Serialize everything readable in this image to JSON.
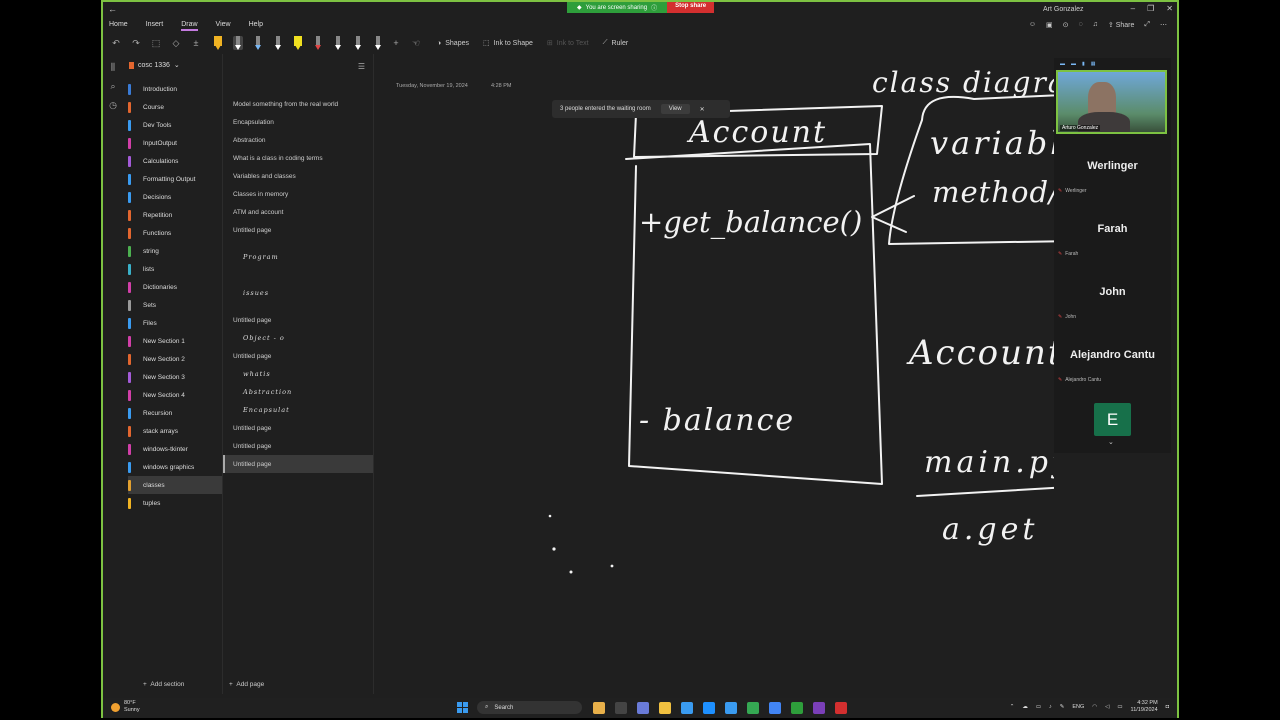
{
  "titlebar": {
    "share_status": "You are screen sharing",
    "stop_share": "Stop share",
    "user_name": "Art Gonzalez"
  },
  "menu": {
    "home": "Home",
    "insert": "Insert",
    "draw": "Draw",
    "view": "View",
    "help": "Help"
  },
  "header_actions": {
    "share": "Share"
  },
  "toolbar": {
    "shapes": "Shapes",
    "ink_to_shape": "Ink to Shape",
    "ink_to_text": "Ink to Text",
    "ruler": "Ruler",
    "pen_colors": [
      "#f0b323",
      "#ffffff",
      "#7ab8f5",
      "#ffffff",
      "#f0e020",
      "#e04545",
      "#ffffff",
      "#ffffff",
      "#ffffff"
    ]
  },
  "notebook": {
    "title": "cosc 1336"
  },
  "sections": [
    {
      "label": "Introduction",
      "color": "#3a7bd5"
    },
    {
      "label": "Course",
      "color": "#e2662f"
    },
    {
      "label": "Dev Tools",
      "color": "#3a9bf0"
    },
    {
      "label": "InputOutput",
      "color": "#d13fa8"
    },
    {
      "label": "Calculations",
      "color": "#a45bd8"
    },
    {
      "label": "Formatting Output",
      "color": "#3a9bf0"
    },
    {
      "label": "Decisions",
      "color": "#3a9bf0"
    },
    {
      "label": "Repetition",
      "color": "#e2662f"
    },
    {
      "label": "Functions",
      "color": "#e2662f"
    },
    {
      "label": "string",
      "color": "#4cb050"
    },
    {
      "label": "lists",
      "color": "#3ab0c8"
    },
    {
      "label": "Dictionaries",
      "color": "#d13fa8"
    },
    {
      "label": "Sets",
      "color": "#9a9a9a"
    },
    {
      "label": "Files",
      "color": "#3a9bf0"
    },
    {
      "label": "New Section 1",
      "color": "#d13fa8"
    },
    {
      "label": "New Section 2",
      "color": "#e2662f"
    },
    {
      "label": "New Section 3",
      "color": "#a45bd8"
    },
    {
      "label": "New Section 4",
      "color": "#d13fa8"
    },
    {
      "label": "Recursion",
      "color": "#3a9bf0"
    },
    {
      "label": "stack arrays",
      "color": "#e2662f"
    },
    {
      "label": "windows-tkinter",
      "color": "#d13fa8"
    },
    {
      "label": "windows graphics",
      "color": "#3a9bf0"
    },
    {
      "label": "classes",
      "color": "#e2a02f"
    },
    {
      "label": "tuples",
      "color": "#f0b323"
    }
  ],
  "add_section": "Add section",
  "pages": [
    {
      "label": "Model something from the real world",
      "type": "text"
    },
    {
      "label": "Encapsulation",
      "type": "text"
    },
    {
      "label": "Abstraction",
      "type": "text"
    },
    {
      "label": "What is a class in coding terms",
      "type": "text"
    },
    {
      "label": "Variables and classes",
      "type": "text"
    },
    {
      "label": "Classes in memory",
      "type": "text"
    },
    {
      "label": "ATM and account",
      "type": "text"
    },
    {
      "label": "Untitled page",
      "type": "text"
    },
    {
      "label": "Program",
      "type": "ink",
      "tall": true
    },
    {
      "label": "issues",
      "type": "ink",
      "tall": true
    },
    {
      "label": "Untitled page",
      "type": "text"
    },
    {
      "label": "Object - o",
      "type": "ink"
    },
    {
      "label": "Untitled page",
      "type": "text"
    },
    {
      "label": "whatis",
      "type": "ink"
    },
    {
      "label": "Abstraction",
      "type": "ink"
    },
    {
      "label": "Encapsulat",
      "type": "ink"
    },
    {
      "label": "Untitled page",
      "type": "text"
    },
    {
      "label": "Untitled page",
      "type": "text"
    },
    {
      "label": "Untitled page",
      "type": "text",
      "selected": true
    }
  ],
  "add_page": "Add page",
  "canvas": {
    "date": "Tuesday, November 19, 2024",
    "time": "4:28 PM",
    "toast_text": "3 people entered the waiting room",
    "toast_view": "View",
    "ink": {
      "class_diagram": "class diagram",
      "account": "Account",
      "get_balance": "+get_balance()",
      "balance": "- balance",
      "variables": "variables",
      "method": "method/functions",
      "account_a": "Account a;",
      "main_py": "main.py",
      "a_get": "a.get"
    }
  },
  "participants": {
    "video_label": "Arturo Gonzalez",
    "list": [
      {
        "name": "Werlinger",
        "mini": "Werlinger"
      },
      {
        "name": "Farah",
        "mini": "Farah"
      },
      {
        "name": "John",
        "mini": "John"
      },
      {
        "name": "Alejandro Cantu",
        "mini": "Alejandro Cantu"
      }
    ],
    "avatar_letter": "E"
  },
  "taskbar": {
    "temp": "80°F",
    "weather": "Sunny",
    "search": "Search",
    "lang": "ENG",
    "time": "4:32 PM",
    "date": "11/19/2024",
    "app_colors": [
      "#e8b04a",
      "#444",
      "#6a7bd8",
      "#f0c040",
      "#3a9bf0",
      "#1e90ff",
      "#3a9bf0",
      "#35a853",
      "#4285f4",
      "#2e9e3b",
      "#7a3fb8",
      "#d32f2f"
    ]
  }
}
